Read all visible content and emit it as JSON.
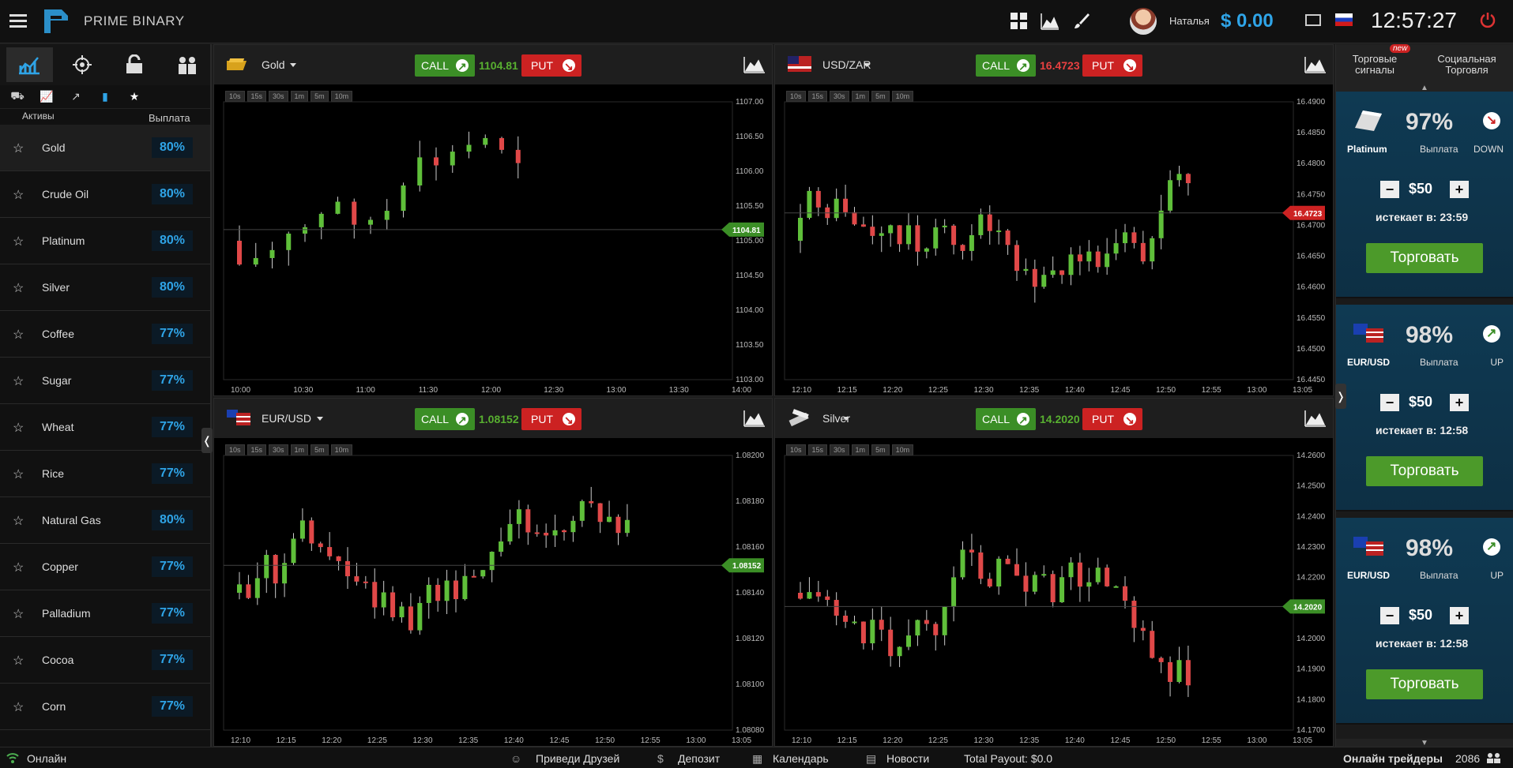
{
  "header": {
    "brand": "PRIME BINARY",
    "user_name": "Наталья",
    "balance": "$ 0.00",
    "time": "12:57:27"
  },
  "sidebar": {
    "assets_label": "Активы",
    "payout_label": "Выплата",
    "assets": [
      {
        "name": "Gold",
        "payout": "80%"
      },
      {
        "name": "Crude Oil",
        "payout": "80%"
      },
      {
        "name": "Platinum",
        "payout": "80%"
      },
      {
        "name": "Silver",
        "payout": "80%"
      },
      {
        "name": "Coffee",
        "payout": "77%"
      },
      {
        "name": "Sugar",
        "payout": "77%"
      },
      {
        "name": "Wheat",
        "payout": "77%"
      },
      {
        "name": "Rice",
        "payout": "77%"
      },
      {
        "name": "Natural Gas",
        "payout": "80%"
      },
      {
        "name": "Copper",
        "payout": "77%"
      },
      {
        "name": "Palladium",
        "payout": "77%"
      },
      {
        "name": "Cocoa",
        "payout": "77%"
      },
      {
        "name": "Corn",
        "payout": "77%"
      }
    ]
  },
  "timeframes": [
    "10s",
    "15s",
    "30s",
    "1m",
    "5m",
    "10m"
  ],
  "buttons": {
    "call": "CALL",
    "put": "PUT"
  },
  "charts": [
    {
      "asset": "Gold",
      "price": "1104.81",
      "direction": "up",
      "x_ticks": [
        "10:00",
        "10:30",
        "11:00",
        "11:30",
        "12:00",
        "12:30",
        "13:00",
        "13:30",
        "14:00"
      ],
      "y_ticks": [
        "1107.00",
        "1106.50",
        "1106.00",
        "1105.50",
        "1105.00",
        "1104.50",
        "1104.00",
        "1103.50",
        "1103.00"
      ],
      "current_label": "1104.81"
    },
    {
      "asset": "USD/ZAR",
      "price": "16.4723",
      "direction": "down",
      "x_ticks": [
        "12:10",
        "12:15",
        "12:20",
        "12:25",
        "12:30",
        "12:35",
        "12:40",
        "12:45",
        "12:50",
        "12:55",
        "13:00",
        "13:05"
      ],
      "y_ticks": [
        "16.4900",
        "16.4850",
        "16.4800",
        "16.4750",
        "16.4700",
        "16.4650",
        "16.4600",
        "16.4550",
        "16.4500",
        "16.4450"
      ],
      "current_label": "16.4723"
    },
    {
      "asset": "EUR/USD",
      "price": "1.08152",
      "direction": "up",
      "x_ticks": [
        "12:10",
        "12:15",
        "12:20",
        "12:25",
        "12:30",
        "12:35",
        "12:40",
        "12:45",
        "12:50",
        "12:55",
        "13:00",
        "13:05"
      ],
      "y_ticks": [
        "1.08200",
        "1.08180",
        "1.08160",
        "1.08140",
        "1.08120",
        "1.08100",
        "1.08080"
      ],
      "current_label": "1.08152"
    },
    {
      "asset": "Silver",
      "price": "14.2020",
      "direction": "up",
      "x_ticks": [
        "12:10",
        "12:15",
        "12:20",
        "12:25",
        "12:30",
        "12:35",
        "12:40",
        "12:45",
        "12:50",
        "12:55",
        "13:00",
        "13:05"
      ],
      "y_ticks": [
        "14.2600",
        "14.2500",
        "14.2400",
        "14.2300",
        "14.2200",
        "14.2100",
        "14.2000",
        "14.1900",
        "14.1800",
        "14.1700"
      ],
      "current_label": "14.2020"
    }
  ],
  "right_panel": {
    "tab_signals": "Торговые сигналы",
    "tab_new": "new",
    "tab_social": "Социальная Торговля",
    "payout_label": "Выплата",
    "trade_label": "Торговать",
    "cards": [
      {
        "asset": "Platinum",
        "pct": "97%",
        "direction": "DOWN",
        "amount": "$50",
        "expires": "истекает в: 23:59"
      },
      {
        "asset": "EUR/USD",
        "pct": "98%",
        "direction": "UP",
        "amount": "$50",
        "expires": "истекает в: 12:58"
      },
      {
        "asset": "EUR/USD",
        "pct": "98%",
        "direction": "UP",
        "amount": "$50",
        "expires": "истекает в: 12:58"
      }
    ]
  },
  "footer": {
    "online": "Онлайн",
    "invite": "Приведи Друзей",
    "deposit": "Депозит",
    "calendar": "Календарь",
    "news": "Новости",
    "total_payout": "Total Payout: $0.0",
    "online_traders_label": "Онлайн трейдеры",
    "online_traders_count": "2086"
  }
}
